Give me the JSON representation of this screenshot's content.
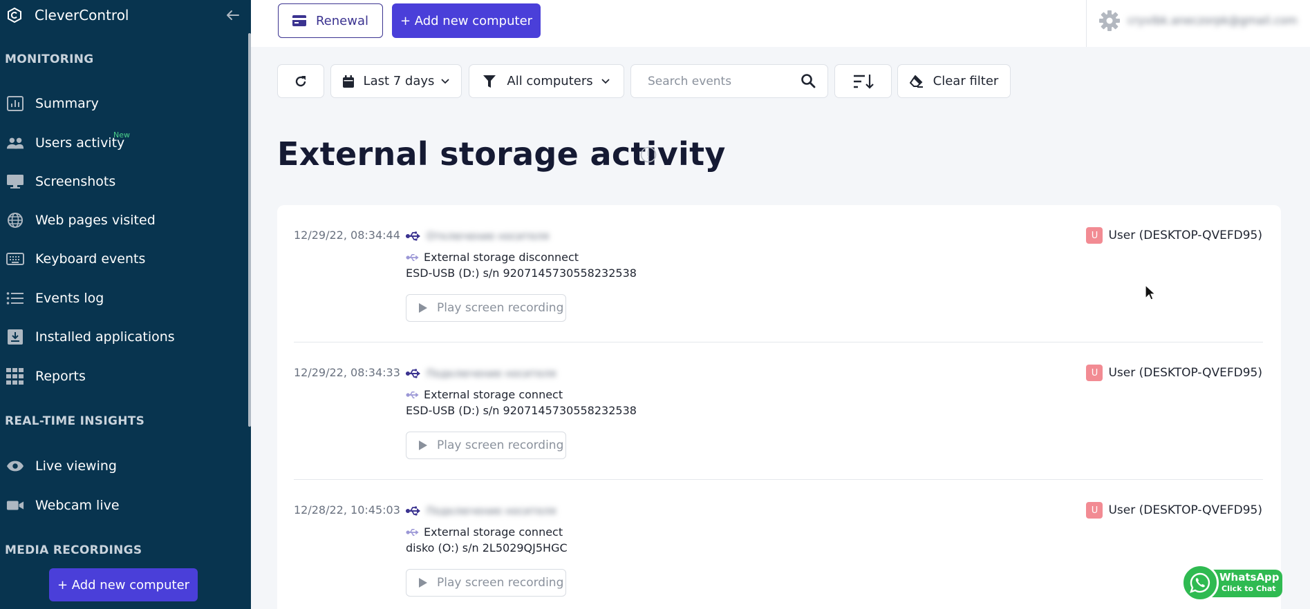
{
  "app": {
    "name": "CleverControl"
  },
  "sidebar": {
    "sections": {
      "monitoring": "MONITORING",
      "realtime": "REAL-TIME INSIGHTS",
      "media": "MEDIA RECORDINGS"
    },
    "items": [
      {
        "label": "Summary",
        "icon": "bar-chart-icon"
      },
      {
        "label": "Users activity",
        "icon": "users-icon",
        "badge": "New"
      },
      {
        "label": "Screenshots",
        "icon": "monitor-icon"
      },
      {
        "label": "Web pages visited",
        "icon": "globe-icon"
      },
      {
        "label": "Keyboard events",
        "icon": "keyboard-icon"
      },
      {
        "label": "Events log",
        "icon": "list-icon"
      },
      {
        "label": "Installed applications",
        "icon": "install-icon"
      },
      {
        "label": "Reports",
        "icon": "grid-icon"
      },
      {
        "label": "Live viewing",
        "icon": "eye-icon"
      },
      {
        "label": "Webcam live",
        "icon": "video-camera-icon"
      }
    ],
    "add_button": "+ Add new computer"
  },
  "topbar": {
    "renewal": "Renewal",
    "add_computer": "+ Add new computer",
    "user_email": "cryvibk.aneczorpk@gmail.com"
  },
  "toolbar": {
    "date_range": "Last 7 days",
    "computers": "All computers",
    "search_placeholder": "Search events",
    "clear_filter": "Clear filter"
  },
  "page": {
    "title": "External storage activity"
  },
  "events": [
    {
      "time": "12/29/22, 08:34:44",
      "blurred_title": "Отключение носителя",
      "type": "External storage disconnect",
      "device": "ESD-USB (D:) s/n 9207145730558232538",
      "play_label": "Play screen recording",
      "user_avatar": "U",
      "user": "User (DESKTOP-QVEFD95)"
    },
    {
      "time": "12/29/22, 08:34:33",
      "blurred_title": "Подключение носителя",
      "type": "External storage connect",
      "device": "ESD-USB (D:) s/n 9207145730558232538",
      "play_label": "Play screen recording",
      "user_avatar": "U",
      "user": "User (DESKTOP-QVEFD95)"
    },
    {
      "time": "12/28/22, 10:45:03",
      "blurred_title": "Подключение носителя",
      "type": "External storage connect",
      "device": "disko (O:) s/n 2L5029QJ5HGC",
      "play_label": "Play screen recording",
      "user_avatar": "U",
      "user": "User (DESKTOP-QVEFD95)"
    }
  ],
  "whatsapp": {
    "title": "WhatsApp",
    "subtitle": "Click to Chat"
  },
  "colors": {
    "sidebar_bg": "#08344f",
    "accent": "#4a3fd9",
    "renewal_border": "#3b3390",
    "avatar": "#f28b93",
    "whatsapp": "#2fba51",
    "new_badge": "#4cd08a"
  }
}
